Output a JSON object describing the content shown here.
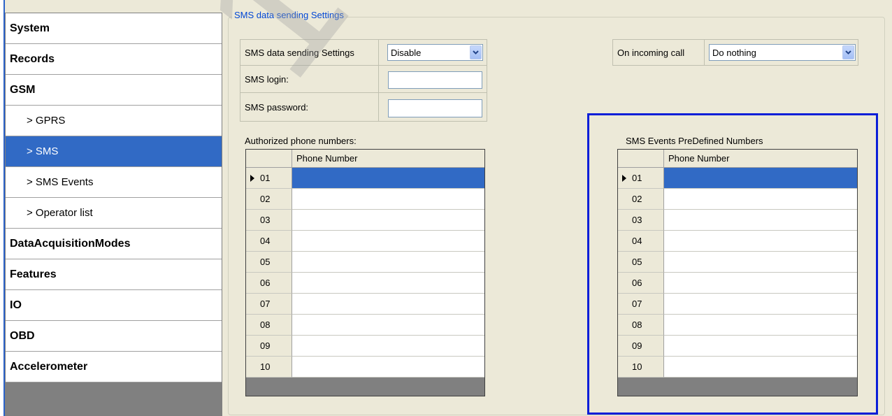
{
  "sidebar": {
    "items": [
      {
        "label": "System",
        "sub": false,
        "active": false
      },
      {
        "label": "Records",
        "sub": false,
        "active": false
      },
      {
        "label": "GSM",
        "sub": false,
        "active": false
      },
      {
        "label": "> GPRS",
        "sub": true,
        "active": false
      },
      {
        "label": "> SMS",
        "sub": true,
        "active": true
      },
      {
        "label": "> SMS Events",
        "sub": true,
        "active": false
      },
      {
        "label": "> Operator list",
        "sub": true,
        "active": false
      },
      {
        "label": "DataAcquisitionModes",
        "sub": false,
        "active": false
      },
      {
        "label": "Features",
        "sub": false,
        "active": false
      },
      {
        "label": "IO",
        "sub": false,
        "active": false
      },
      {
        "label": "OBD",
        "sub": false,
        "active": false
      },
      {
        "label": "Accelerometer",
        "sub": false,
        "active": false
      }
    ]
  },
  "group": {
    "legend": "SMS data sending Settings"
  },
  "form": {
    "sending_label": "SMS data sending Settings",
    "sending_value": "Disable",
    "login_label": "SMS login:",
    "login_value": "",
    "password_label": "SMS password:",
    "password_value": "",
    "incoming_label": "On incoming call",
    "incoming_value": "Do nothing"
  },
  "authorized": {
    "caption": "Authorized phone numbers:",
    "column": "Phone Number",
    "rows": [
      "01",
      "02",
      "03",
      "04",
      "05",
      "06",
      "07",
      "08",
      "09",
      "10"
    ]
  },
  "predefined": {
    "caption": "SMS Events PreDefined Numbers",
    "column": "Phone Number",
    "rows": [
      "01",
      "02",
      "03",
      "04",
      "05",
      "06",
      "07",
      "08",
      "09",
      "10"
    ]
  },
  "watermark": "130.C",
  "colors": {
    "selection": "#316ac5",
    "highlight": "#0a1ed8",
    "legend": "#0046d5"
  }
}
